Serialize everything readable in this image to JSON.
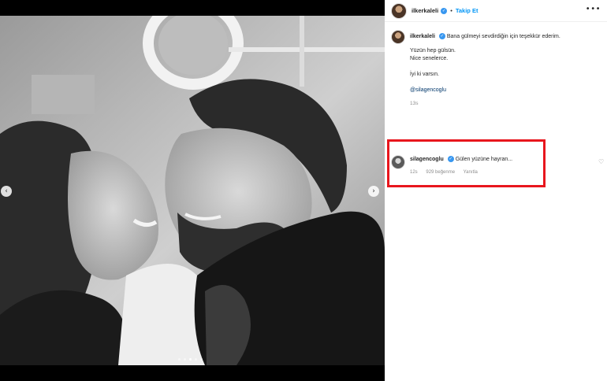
{
  "post": {
    "author": "ilkerkaleli",
    "follow_label": "Takip Et",
    "separator": "•",
    "more_label": "•••",
    "caption_first_line": "Bana gülmeyi sevdirdiğin için teşekkür ederim.",
    "caption_lines": [
      "Yüzün hep gülsün.",
      "Nice senelerce.",
      "İyi ki varsın."
    ],
    "mention": "@silagencoglu",
    "time": "13s"
  },
  "comment": {
    "author": "silagencoglu",
    "text": "Gülen yüzüne hayran...",
    "time": "12s",
    "likes": "929 beğenme",
    "reply": "Yanıtla"
  },
  "carousel": {
    "prev_icon": "‹",
    "next_icon": "›",
    "dot_count": 5,
    "active_dot": 2
  },
  "icons": {
    "verified": "✓",
    "heart": "♡"
  },
  "colors": {
    "link_blue": "#0095f6",
    "verified_blue": "#3897f0",
    "highlight_red": "#e8161d",
    "meta_grey": "#8e8e8e"
  }
}
